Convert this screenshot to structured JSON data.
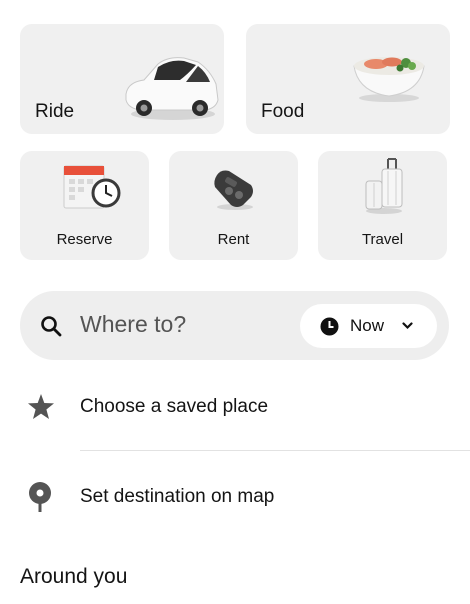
{
  "tiles": {
    "ride": {
      "label": "Ride"
    },
    "food": {
      "label": "Food"
    },
    "reserve": {
      "label": "Reserve"
    },
    "rent": {
      "label": "Rent"
    },
    "travel": {
      "label": "Travel"
    }
  },
  "search": {
    "placeholder": "Where to?",
    "schedule_label": "Now"
  },
  "shortcuts": [
    {
      "label": "Choose a saved place",
      "icon": "star-icon"
    },
    {
      "label": "Set destination on map",
      "icon": "map-pin-icon"
    }
  ],
  "sections": {
    "around_you": "Around you"
  },
  "colors": {
    "tile_bg": "#f0f0f0",
    "search_bg": "#eeeeee",
    "icon_dark": "#545454"
  }
}
